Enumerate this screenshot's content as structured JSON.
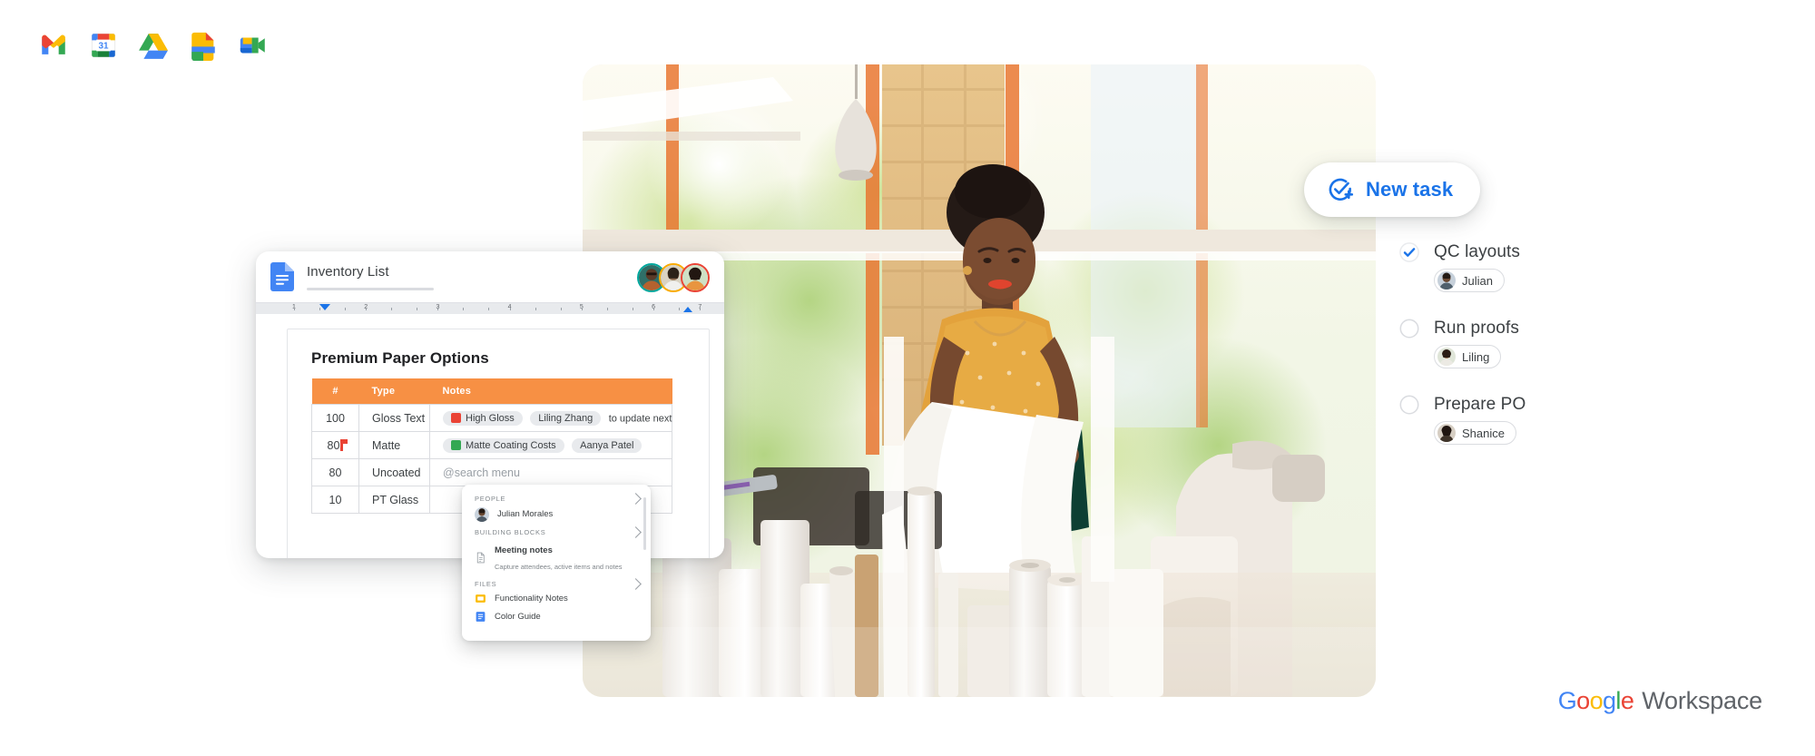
{
  "app_strip": {
    "icons": [
      {
        "name": "gmail-icon",
        "label": "Gmail"
      },
      {
        "name": "google-calendar-icon",
        "label": "Calendar",
        "day": "31"
      },
      {
        "name": "google-drive-icon",
        "label": "Drive"
      },
      {
        "name": "google-slides-icon",
        "label": "Slides"
      },
      {
        "name": "google-meet-icon",
        "label": "Meet"
      }
    ]
  },
  "docs_window": {
    "title": "Inventory List",
    "collaborators": [
      "Julian Morales",
      "Liling Zhang",
      "Aanya Patel"
    ],
    "ruler": {
      "marks": [
        "1",
        "2",
        "3",
        "4",
        "5",
        "6",
        "7"
      ]
    },
    "document": {
      "heading": "Premium Paper Options",
      "table": {
        "columns": [
          "#",
          "Type",
          "Notes"
        ],
        "rows": [
          {
            "num": "100",
            "type": "Gloss Text",
            "chips": [
              {
                "label": "High Gloss",
                "icon": "pdf-file-icon"
              },
              {
                "label": "Liling Zhang",
                "icon": "person-chip"
              }
            ],
            "trailing_text": "to update next"
          },
          {
            "num": "80",
            "type": "Matte",
            "has_cursor": true,
            "chips": [
              {
                "label": "Matte Coating Costs",
                "icon": "sheets-file-icon"
              },
              {
                "label": "Aanya Patel",
                "icon": "person-chip"
              }
            ],
            "trailing_text": ""
          },
          {
            "num": "80",
            "type": "Uncoated",
            "chips": [],
            "placeholder": "@search menu"
          },
          {
            "num": "10",
            "type": "PT Glass",
            "chips": []
          }
        ]
      }
    }
  },
  "at_menu": {
    "sections": [
      {
        "label": "PEOPLE",
        "items": [
          {
            "title": "Julian Morales",
            "subtitle": "",
            "icon": "person-avatar"
          }
        ]
      },
      {
        "label": "BUILDING BLOCKS",
        "items": [
          {
            "title": "Meeting notes",
            "subtitle": "Capture attendees, active items and notes",
            "icon": "document-outline-icon"
          }
        ]
      },
      {
        "label": "FILES",
        "items": [
          {
            "title": "Functionality Notes",
            "subtitle": "",
            "icon": "slides-file-icon"
          },
          {
            "title": "Color Guide",
            "subtitle": "",
            "icon": "docs-file-icon"
          }
        ]
      }
    ]
  },
  "new_task_button": {
    "label": "New task",
    "icon": "add-task-icon",
    "accent": "#1a73e8"
  },
  "tasks": [
    {
      "title": "QC layouts",
      "checked": true,
      "assignee": "Julian"
    },
    {
      "title": "Run proofs",
      "checked": false,
      "assignee": "Liling"
    },
    {
      "title": "Prepare PO",
      "checked": false,
      "assignee": "Shanice"
    }
  ],
  "footer": {
    "brand_letters": [
      "G",
      "o",
      "o",
      "g",
      "l",
      "e"
    ],
    "product": "Workspace"
  },
  "colors": {
    "table_header": "#f79044",
    "accent_blue": "#1a73e8",
    "google_blue": "#4285f4",
    "google_red": "#ea4335",
    "google_yellow": "#fbbc04",
    "google_green": "#34a853",
    "text_primary": "#3c4043",
    "text_secondary": "#80868b"
  }
}
